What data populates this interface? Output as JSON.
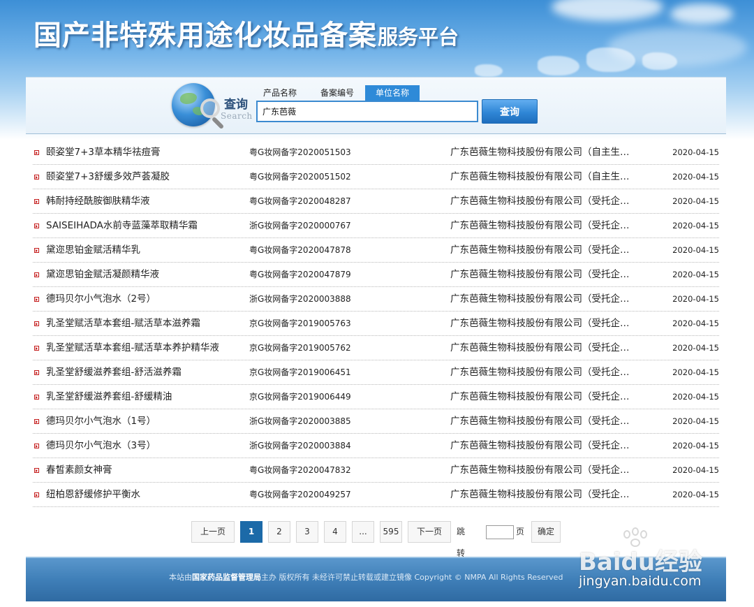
{
  "header": {
    "title": "国产非特殊用途化妆品备案",
    "subtitle": "服务平台"
  },
  "search": {
    "label": "查询",
    "label_en": "Search",
    "tabs": [
      {
        "label": "产品名称",
        "active": false
      },
      {
        "label": "备案编号",
        "active": false
      },
      {
        "label": "单位名称",
        "active": true
      }
    ],
    "query": "广东芭薇",
    "button": "查询"
  },
  "results": [
    {
      "name": "颐姿堂7+3草本精华祛痘膏",
      "code": "粤G妆网备字2020051503",
      "company": "广东芭薇生物科技股份有限公司（自主生…",
      "date": "2020-04-15"
    },
    {
      "name": "颐姿堂7+3舒缓多效芦荟凝胶",
      "code": "粤G妆网备字2020051502",
      "company": "广东芭薇生物科技股份有限公司（自主生…",
      "date": "2020-04-15"
    },
    {
      "name": "韩耐持经酰胺御肤精华液",
      "code": "粤G妆网备字2020048287",
      "company": "广东芭薇生物科技股份有限公司（受托企…",
      "date": "2020-04-15"
    },
    {
      "name": "SAISEIHADA水前寺蓝藻萃取精华霜",
      "code": "浙G妆网备字2020000767",
      "company": "广东芭薇生物科技股份有限公司（受托企…",
      "date": "2020-04-15"
    },
    {
      "name": "黛迩思铂金赋活精华乳",
      "code": "粤G妆网备字2020047878",
      "company": "广东芭薇生物科技股份有限公司（受托企…",
      "date": "2020-04-15"
    },
    {
      "name": "黛迩思铂金赋活凝颜精华液",
      "code": "粤G妆网备字2020047879",
      "company": "广东芭薇生物科技股份有限公司（受托企…",
      "date": "2020-04-15"
    },
    {
      "name": "德玛贝尔小气泡水（2号）",
      "code": "浙G妆网备字2020003888",
      "company": "广东芭薇生物科技股份有限公司（受托企…",
      "date": "2020-04-15"
    },
    {
      "name": "乳圣堂赋活草本套组-赋活草本滋养霜",
      "code": "京G妆网备字2019005763",
      "company": "广东芭薇生物科技股份有限公司（受托企…",
      "date": "2020-04-15"
    },
    {
      "name": "乳圣堂赋活草本套组-赋活草本养护精华液",
      "code": "京G妆网备字2019005762",
      "company": "广东芭薇生物科技股份有限公司（受托企…",
      "date": "2020-04-15"
    },
    {
      "name": "乳圣堂舒缓滋养套组-舒活滋养霜",
      "code": "京G妆网备字2019006451",
      "company": "广东芭薇生物科技股份有限公司（受托企…",
      "date": "2020-04-15"
    },
    {
      "name": "乳圣堂舒缓滋养套组-舒缓精油",
      "code": "京G妆网备字2019006449",
      "company": "广东芭薇生物科技股份有限公司（受托企…",
      "date": "2020-04-15"
    },
    {
      "name": "德玛贝尔小气泡水（1号）",
      "code": "浙G妆网备字2020003885",
      "company": "广东芭薇生物科技股份有限公司（受托企…",
      "date": "2020-04-15"
    },
    {
      "name": "德玛贝尔小气泡水（3号）",
      "code": "浙G妆网备字2020003884",
      "company": "广东芭薇生物科技股份有限公司（受托企…",
      "date": "2020-04-15"
    },
    {
      "name": "春皙素颜女神膏",
      "code": "粤G妆网备字2020047832",
      "company": "广东芭薇生物科技股份有限公司（受托企…",
      "date": "2020-04-15"
    },
    {
      "name": "纽柏恩舒缓修护平衡水",
      "code": "粤G妆网备字2020049257",
      "company": "广东芭薇生物科技股份有限公司（受托企…",
      "date": "2020-04-15"
    }
  ],
  "pagination": {
    "prev": "上一页",
    "pages": [
      "1",
      "2",
      "3",
      "4"
    ],
    "current": "1",
    "ellipsis": "...",
    "last": "595",
    "next": "下一页",
    "jump_label": "跳转到",
    "page_unit": "页",
    "confirm": "确定"
  },
  "footer": {
    "prefix": "本站由",
    "org": "国家药品监督管理局",
    "suffix": "主办 版权所有 未经许可禁止转载或建立镜像 Copyright © NMPA All Rights Reserved"
  },
  "watermark": {
    "logo": "Baidu经验",
    "url": "jingyan.baidu.com"
  },
  "colors": {
    "accent": "#2e8ad8",
    "active_page": "#1c6aa8",
    "bullet": "#c41a1a",
    "footer": "#3f7fb8"
  }
}
